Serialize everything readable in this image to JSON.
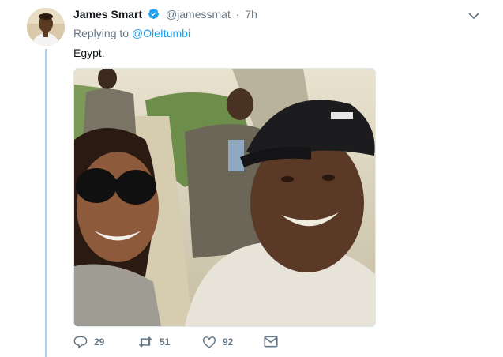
{
  "tweet": {
    "author_name": "James Smart",
    "handle": "@jamessmat",
    "separator": "·",
    "time": "7h",
    "replying_prefix": "Replying to",
    "replying_to": "@OleItumbi",
    "text": "Egypt.",
    "verified": true
  },
  "actions": {
    "replies": "29",
    "retweets": "51",
    "likes": "92"
  },
  "icons": {
    "verified": "verified-badge-icon",
    "caret": "chevron-down-icon",
    "reply": "reply-icon",
    "retweet": "retweet-icon",
    "like": "heart-icon",
    "message": "envelope-icon"
  },
  "colors": {
    "accent": "#1da1f2",
    "muted": "#657786",
    "thread_line": "#a7d7f4",
    "text": "#14171a"
  }
}
